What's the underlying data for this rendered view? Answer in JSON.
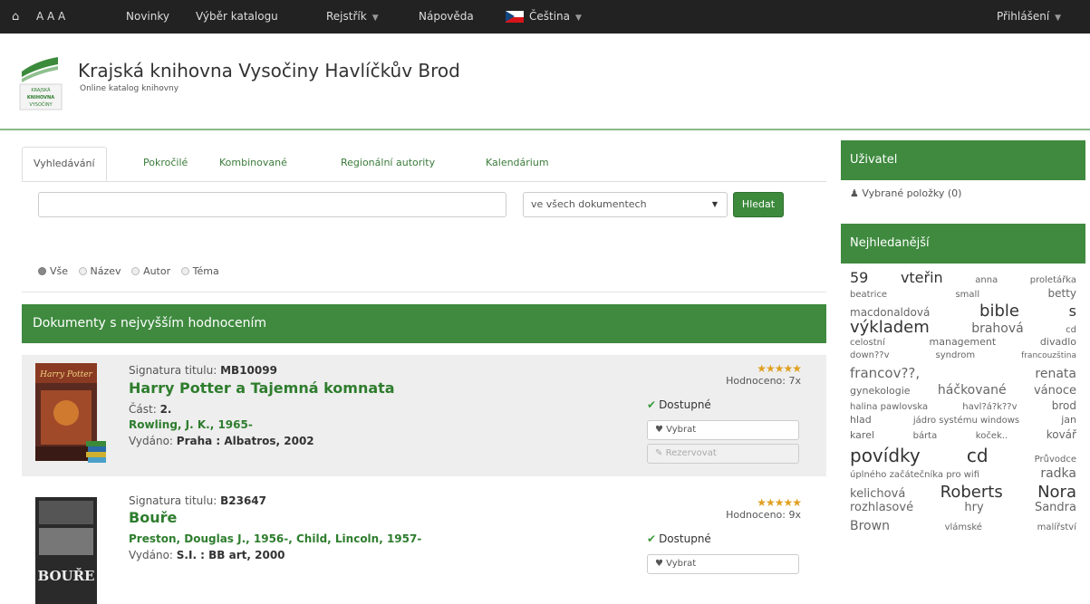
{
  "nav": {
    "home_icon": "home-icon",
    "font_size": "A A A",
    "novinky": "Novinky",
    "vyber_katalogu": "Výběr katalogu",
    "rejstrik": "Rejstřík",
    "napoveda": "Nápověda",
    "language": "Čeština",
    "prihlaseni": "Přihlášení"
  },
  "header": {
    "title": "Krajská knihovna Vysočiny Havlíčkův Brod",
    "subtitle": "Online katalog knihovny",
    "logo_text": [
      "KRAJSKÁ",
      "KNIHOVNA",
      "VYSOČINY"
    ]
  },
  "tabs": [
    "Vyhledávání",
    "Pokročilé",
    "Kombinované",
    "Regionální autority",
    "Kalendárium"
  ],
  "search": {
    "value": "",
    "scope": "ve všech dokumentech",
    "button": "Hledat"
  },
  "radios": [
    "Vše",
    "Název",
    "Autor",
    "Téma"
  ],
  "panel_title": "Dokumenty s nejvyšším hodnocením",
  "books": [
    {
      "sig_label": "Signatura titulu:",
      "sig": "MB10099",
      "title": "Harry Potter a Tajemná komnata",
      "part_label": "Část:",
      "part": "2.",
      "author": "Rowling, J. K., 1965-",
      "pub_label": "Vydáno:",
      "pub": "Praha : Albatros, 2002",
      "rating_text": "Hodnoceno: 7x",
      "status": "Dostupné",
      "btn_select": "Vybrat",
      "btn_reserve": "Rezervovat",
      "cover_text": "Harry Potter"
    },
    {
      "sig_label": "Signatura titulu:",
      "sig": "B23647",
      "title": "Bouře",
      "author": "Preston, Douglas J., 1956-, Child, Lincoln, 1957-",
      "pub_label": "Vydáno:",
      "pub": "S.I. : BB art, 2000",
      "rating_text": "Hodnoceno: 9x",
      "status": "Dostupné",
      "btn_select": "Vybrat",
      "cover_text": "BOUŘE"
    }
  ],
  "sidebar": {
    "user_title": "Uživatel",
    "selected_items": "Vybrané položky (0)",
    "popular_title": "Nejhledanější",
    "cloud": [
      [
        "59",
        "vteřin",
        "anna",
        "proletářka"
      ],
      [
        "beatrice",
        "small",
        "betty"
      ],
      [
        "macdonaldová",
        "bible",
        "s"
      ],
      [
        "výkladem",
        "brahová",
        "cd"
      ],
      [
        "celostní",
        "management",
        "divadlo"
      ],
      [
        "down??v",
        "syndrom",
        "francouzština"
      ],
      [
        "francov??,",
        "renata"
      ],
      [
        "gynekologie",
        "háčkované",
        "vánoce"
      ],
      [
        "halina pawlovska",
        "havl?á?k??v",
        "brod"
      ],
      [
        "hlad",
        "jádro systému windows",
        "jan"
      ],
      [
        "karel",
        "bárta",
        "koček..",
        "kovář"
      ],
      [
        "povídky",
        "cd",
        "Průvodce"
      ],
      [
        "úplného začátečníka pro wifi",
        "radka"
      ],
      [
        "kelichová",
        "Roberts",
        "Nora"
      ],
      [
        "rozhlasové",
        "hry",
        "Sandra"
      ],
      [
        "Brown",
        "vlámské",
        "malířství"
      ]
    ]
  }
}
